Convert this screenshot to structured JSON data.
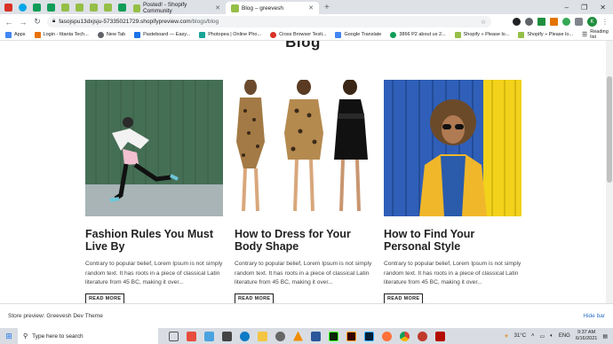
{
  "browser": {
    "tabs": [
      {
        "label": "",
        "color": "#d93025",
        "icon": "gmail-icon"
      },
      {
        "label": "",
        "color": "#00a6ea",
        "icon": "skype-icon"
      },
      {
        "label": "",
        "color": "#0f9d58",
        "icon": "sheets-icon"
      },
      {
        "label": "",
        "color": "#0f9d58",
        "icon": "sheets-icon"
      },
      {
        "label": "",
        "color": "#95bf47",
        "icon": "shopify-icon"
      },
      {
        "label": "",
        "color": "#95bf47",
        "icon": "shopify-icon"
      },
      {
        "label": "",
        "color": "#95bf47",
        "icon": "shopify-icon"
      },
      {
        "label": "",
        "color": "#95bf47",
        "icon": "shopify-icon"
      },
      {
        "label": "",
        "color": "#0f9d58",
        "icon": "sheets-icon"
      },
      {
        "label": "Posted! - Shopify Community",
        "color": "#95bf47",
        "icon": "shopify-icon"
      },
      {
        "label": "Blog – greevesh",
        "color": "#95bf47",
        "icon": "shopify-icon",
        "active": true
      }
    ],
    "new_tab": "+",
    "window_controls": [
      "–",
      "❐",
      "✕"
    ],
    "url_host": "fasojspu13dxjsju-57335021729.shopifypreview.com",
    "url_path": "/blogs/blog",
    "bookmarks": [
      {
        "label": "Apps",
        "color": "#4285f4"
      },
      {
        "label": "Login - Ittanta Tech...",
        "color": "#e8710a"
      },
      {
        "label": "New Tab",
        "color": "#5f6368"
      },
      {
        "label": "Pasteboard — Easy...",
        "color": "#1a73e8"
      },
      {
        "label": "Photopea | Online Pho...",
        "color": "#18a497"
      },
      {
        "label": "Cross Browser Testi...",
        "color": "#d93025"
      },
      {
        "label": "Google Translate",
        "color": "#4285f4"
      },
      {
        "label": "3866 P2 about us 2...",
        "color": "#0f9d58"
      },
      {
        "label": "Shopify » Please lo...",
        "color": "#95bf47"
      },
      {
        "label": "Shopify » Please lo...",
        "color": "#95bf47"
      }
    ],
    "reading_list": "Reading list",
    "avatar_letter": "K"
  },
  "page": {
    "title": "Blog",
    "articles": [
      {
        "title": "Fashion Rules You Must Live By",
        "excerpt": "Contrary to popular belief, Lorem Ipsum is not simply random text. It has roots in a piece of classical Latin literature from 45 BC, making it over...",
        "read_more": "READ MORE"
      },
      {
        "title": "How to Dress for Your Body Shape",
        "excerpt": "Contrary to popular belief, Lorem Ipsum is not simply random text. It has roots in a piece of classical Latin literature from 45 BC, making it over...",
        "read_more": "READ MORE"
      },
      {
        "title": "How to Find Your Personal Style",
        "excerpt": "Contrary to popular belief, Lorem Ipsum is not simply random text. It has roots in a piece of classical Latin literature from 45 BC, making it over...",
        "read_more": "READ MORE"
      }
    ]
  },
  "preview_bar": {
    "label": "Store preview: Greevesh Dev Theme",
    "hide": "Hide bar"
  },
  "taskbar": {
    "search_placeholder": "Type here to search",
    "apps": [
      {
        "icon": "task-view-icon",
        "color": "#555"
      },
      {
        "icon": "office-icon",
        "color": "#e74c3c"
      },
      {
        "icon": "l-app-icon",
        "color": "#4aa3df"
      },
      {
        "icon": "calculator-icon",
        "color": "#444"
      },
      {
        "icon": "edge-icon",
        "color": "#0f7ac6"
      },
      {
        "icon": "file-explorer-icon",
        "color": "#f4c542"
      },
      {
        "icon": "settings-icon",
        "color": "#666"
      },
      {
        "icon": "vlc-icon",
        "color": "#f08c00"
      },
      {
        "icon": "word-icon",
        "color": "#2b579a"
      },
      {
        "icon": "dreamweaver-icon",
        "color": "#35fa00"
      },
      {
        "icon": "illustrator-icon",
        "color": "#ff9a00"
      },
      {
        "icon": "photoshop-icon",
        "color": "#31a8ff"
      },
      {
        "icon": "firefox-icon",
        "color": "#ff7139"
      },
      {
        "icon": "chrome-icon",
        "color": "#db4437"
      },
      {
        "icon": "app-red-icon",
        "color": "#c0392b"
      },
      {
        "icon": "acrobat-icon",
        "color": "#b30b00"
      }
    ],
    "temperature": "31°C",
    "language": "ENG",
    "time": "9:37 AM",
    "date": "6/16/2021"
  }
}
